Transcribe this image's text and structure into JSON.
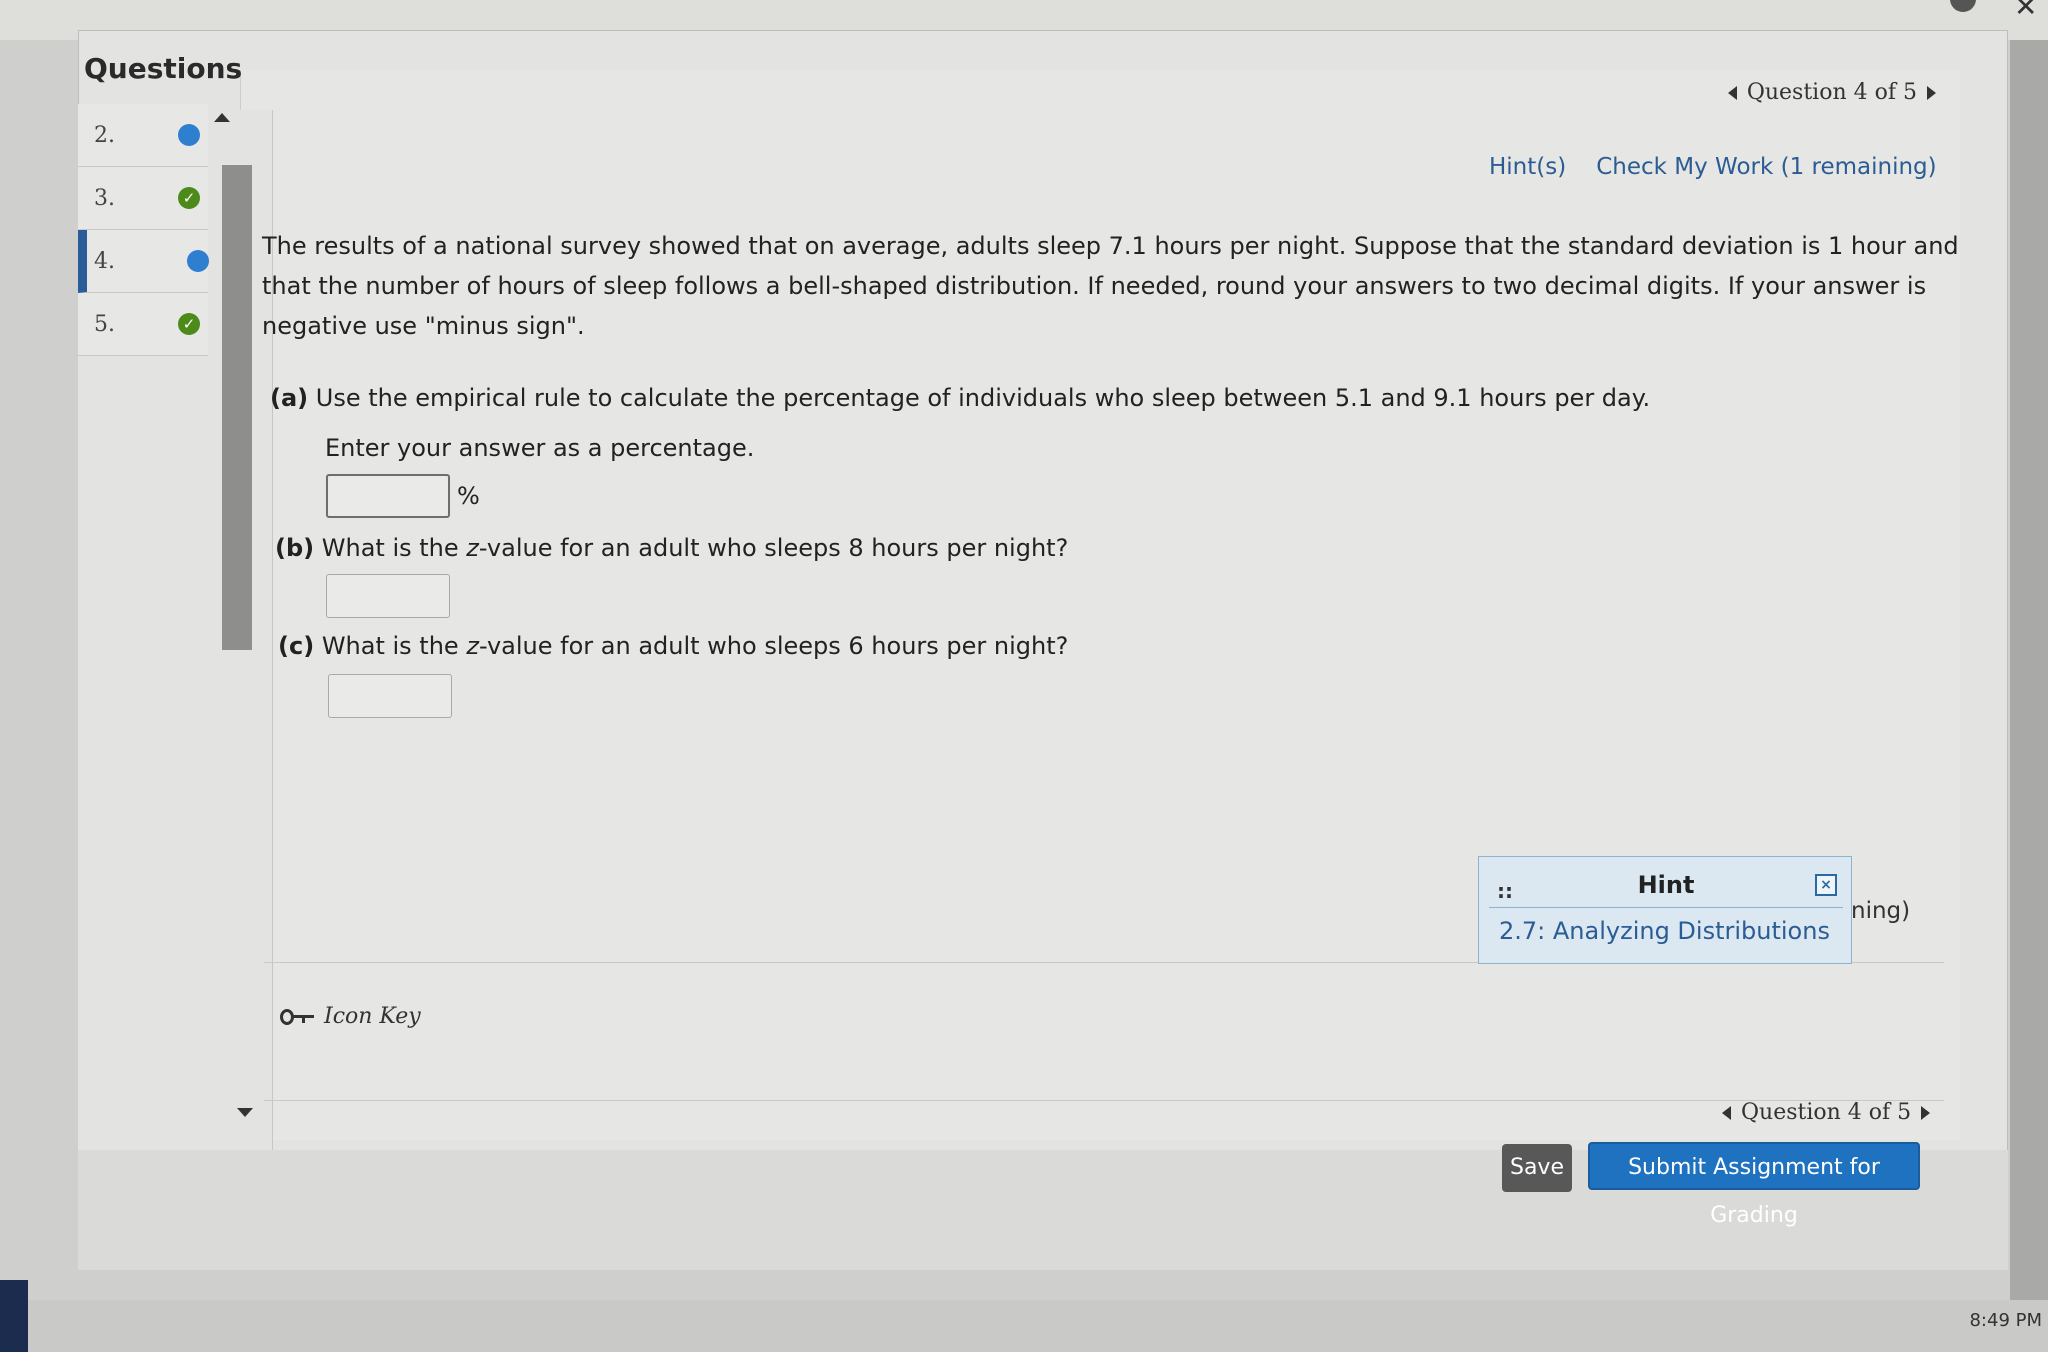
{
  "sidebar": {
    "title": "Questions",
    "items": [
      {
        "number": "2.",
        "status": "in-progress",
        "active": false
      },
      {
        "number": "3.",
        "status": "complete",
        "active": false
      },
      {
        "number": "4.",
        "status": "in-progress",
        "active": true
      },
      {
        "number": "5.",
        "status": "complete",
        "active": false
      }
    ],
    "status_colors": {
      "in_progress": "#2f7fd1",
      "complete": "#4c8a1a"
    }
  },
  "nav": {
    "question_indicator": "Question 4 of 5",
    "hints_label": "Hint(s)",
    "check_work_label": "Check My Work (1 remaining)"
  },
  "problem": {
    "text": "The results of a national survey showed that on average, adults sleep 7.1 hours per night. Suppose that the standard deviation is 1 hour and that the number of hours of sleep follows a bell-shaped distribution. If needed, round your answers to two decimal digits. If your answer is negative use \"minus sign\".",
    "parts": [
      {
        "label": "(a)",
        "text": "Use the empirical rule to calculate the percentage of individuals who sleep between 5.1 and 9.1 hours per day.",
        "instruction": "Enter your answer as a percentage.",
        "unit": "%",
        "value": ""
      },
      {
        "label": "(b)",
        "text_before": "What is the ",
        "z": "z",
        "text_after": "-value for an adult who sleeps 8 hours per night?",
        "value": ""
      },
      {
        "label": "(c)",
        "text_before": "What is the ",
        "z": "z",
        "text_after": "-value for an adult who sleeps 6 hours per night?",
        "value": ""
      }
    ]
  },
  "hint_popup": {
    "title": "Hint",
    "link": "2.7: Analyzing Distributions",
    "behind_text": "ning)"
  },
  "footer": {
    "icon_key_label": "Icon Key",
    "question_indicator": "Question 4 of 5",
    "save_label": "Save",
    "submit_label": "Submit Assignment for Grading"
  },
  "taskbar": {
    "clock": "8:49 PM"
  },
  "colors": {
    "accent": "#1f72c0",
    "link": "#2b5c93"
  }
}
